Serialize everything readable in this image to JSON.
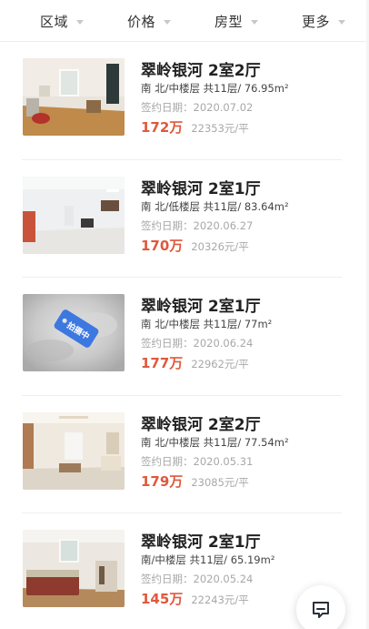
{
  "filters": [
    {
      "label": "区域"
    },
    {
      "label": "价格"
    },
    {
      "label": "房型"
    },
    {
      "label": "更多"
    }
  ],
  "listings": [
    {
      "title": "翠岭银河 2室2厅",
      "meta": "南 北/中楼层 共11层/ 76.95m²",
      "date": "签约日期：2020.07.02",
      "price": "172万",
      "unit_price": "22353元/平",
      "photo": "living-room-photo"
    },
    {
      "title": "翠岭银河 2室1厅",
      "meta": "南 北/低楼层 共11层/ 83.64m²",
      "date": "签约日期：2020.06.27",
      "price": "170万",
      "unit_price": "20326元/平",
      "photo": "living-room-photo"
    },
    {
      "title": "翠岭银河 2室1厅",
      "meta": "南 北/中楼层 共11层/ 77m²",
      "date": "签约日期：2020.06.24",
      "price": "177万",
      "unit_price": "22962元/平",
      "photo": "placeholder-photo",
      "badge": "拍摄中"
    },
    {
      "title": "翠岭银河 2室2厅",
      "meta": "南 北/中楼层 共11层/ 77.54m²",
      "date": "签约日期：2020.05.31",
      "price": "179万",
      "unit_price": "23085元/平",
      "photo": "living-room-photo"
    },
    {
      "title": "翠岭银河 2室1厅",
      "meta": "南/中楼层 共11层/ 65.19m²",
      "date": "签约日期：2020.05.24",
      "price": "145万",
      "unit_price": "22243元/平",
      "photo": "bedroom-photo"
    }
  ],
  "colors": {
    "price": "#e0583c",
    "badge": "#3d78e0",
    "caret": "#c8c8c8"
  },
  "chat_fab": {
    "icon": "chat-icon"
  }
}
